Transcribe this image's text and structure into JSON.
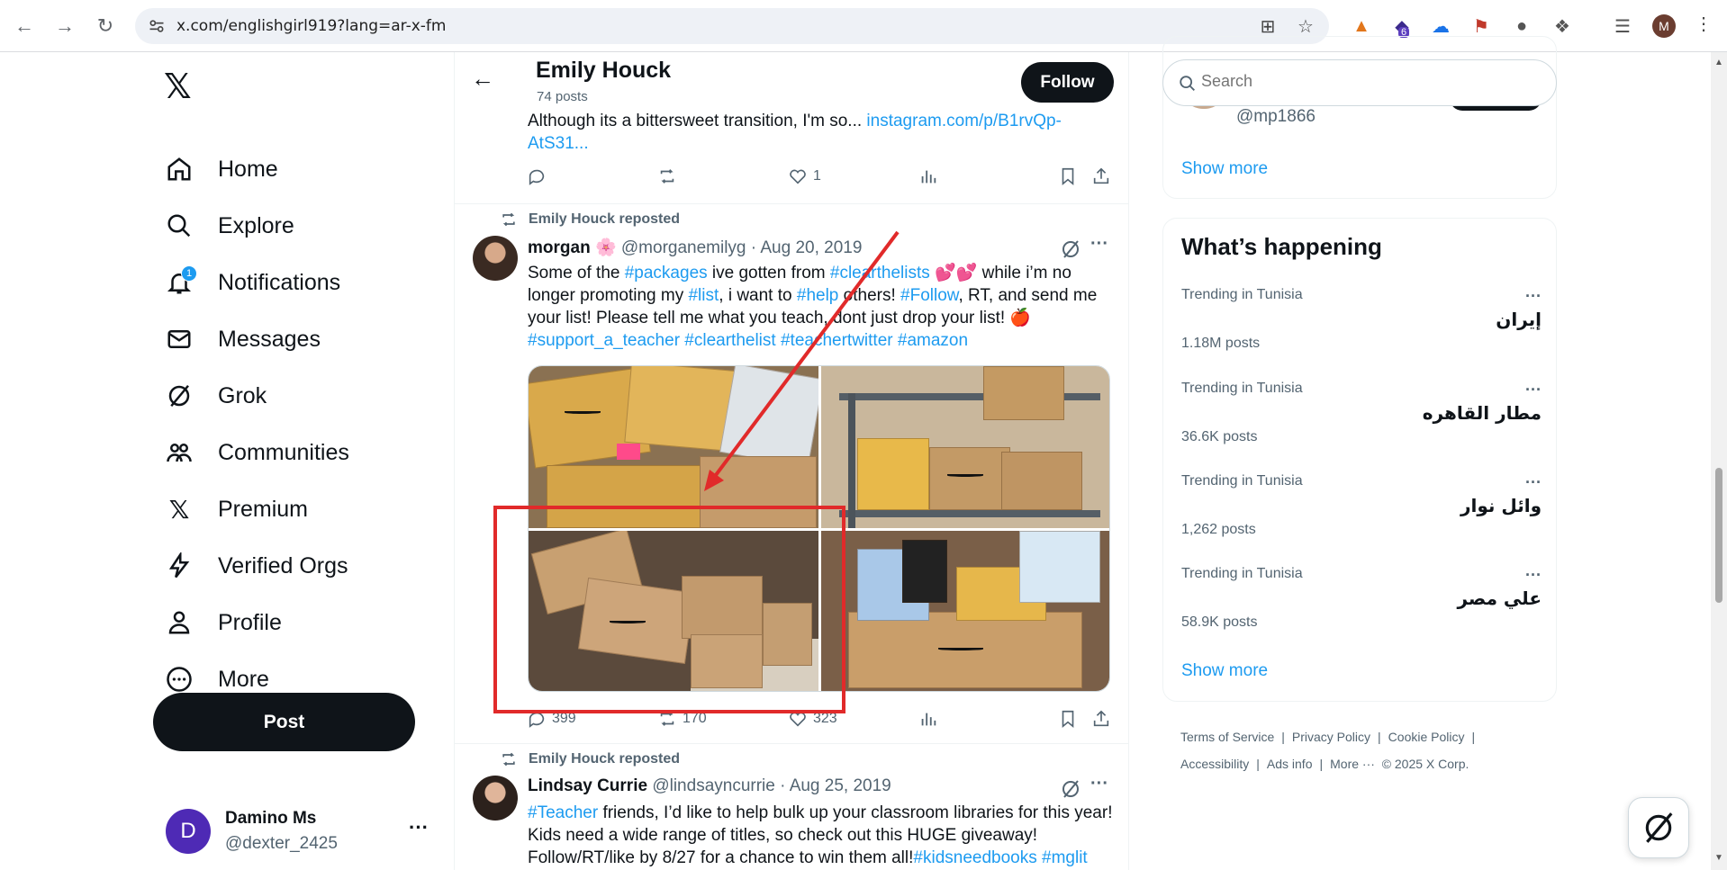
{
  "browser": {
    "url": "x.com/englishgirl919?lang=ar-x-fm",
    "extension_badge": "6",
    "profile_initial": "M"
  },
  "nav": {
    "items": [
      {
        "label": "Home",
        "icon": "home-icon"
      },
      {
        "label": "Explore",
        "icon": "search-icon"
      },
      {
        "label": "Notifications",
        "icon": "bell-icon",
        "badge": "1"
      },
      {
        "label": "Messages",
        "icon": "mail-icon"
      },
      {
        "label": "Grok",
        "icon": "grok-icon"
      },
      {
        "label": "Communities",
        "icon": "people-icon"
      },
      {
        "label": "Premium",
        "icon": "x-logo-icon"
      },
      {
        "label": "Verified Orgs",
        "icon": "lightning-icon"
      },
      {
        "label": "Profile",
        "icon": "person-icon"
      },
      {
        "label": "More",
        "icon": "more-circle-icon"
      }
    ],
    "post_label": "Post"
  },
  "account": {
    "initial": "D",
    "name": "Damino Ms",
    "handle": "@dexter_2425"
  },
  "header": {
    "name": "Emily Houck",
    "posts": "74 posts",
    "follow_label": "Follow"
  },
  "top_tweet": {
    "text": "Although its a bittersweet transition, I'm so... ",
    "link": "instagram.com/p/B1rvQp-AtS31...",
    "likes": "1"
  },
  "tweet1": {
    "repost": "Emily Houck reposted",
    "name": "morgan 🌸",
    "handle": "@morganemilyg",
    "date": "Aug 20, 2019",
    "text_parts": [
      {
        "t": "Some of the ",
        "link": false
      },
      {
        "t": "#packages",
        "link": true
      },
      {
        "t": " ive gotten from ",
        "link": false
      },
      {
        "t": "#clearthelists",
        "link": true
      },
      {
        "t": " 💕💕 while i’m no longer promoting my ",
        "link": false
      },
      {
        "t": "#list",
        "link": true
      },
      {
        "t": ", i want to ",
        "link": false
      },
      {
        "t": "#help",
        "link": true
      },
      {
        "t": " others! ",
        "link": false
      },
      {
        "t": "#Follow",
        "link": true
      },
      {
        "t": ", RT, and send me your list! Please tell me what you teach, dont just drop your list! 🍎 ",
        "link": false
      },
      {
        "t": "#support_a_teacher",
        "link": true
      },
      {
        "t": " ",
        "link": false
      },
      {
        "t": "#clearthelist",
        "link": true
      },
      {
        "t": " ",
        "link": false
      },
      {
        "t": "#teachertwitter",
        "link": true
      },
      {
        "t": " ",
        "link": false
      },
      {
        "t": "#amazon",
        "link": true
      }
    ],
    "replies": "399",
    "reposts": "170",
    "likes": "323"
  },
  "tweet2": {
    "repost": "Emily Houck reposted",
    "name": "Lindsay Currie",
    "handle": "@lindsayncurrie",
    "date": "Aug 25, 2019",
    "text_parts": [
      {
        "t": "#Teacher",
        "link": true
      },
      {
        "t": " friends, I’d like to help bulk up your classroom libraries for this year! Kids need a wide range of titles, so check out this HUGE giveaway! Follow/RT/like by 8/27 for a chance to win them all!",
        "link": false
      },
      {
        "t": "#kidsneedbooks",
        "link": true
      },
      {
        "t": " ",
        "link": false
      },
      {
        "t": "#mglit",
        "link": true
      }
    ]
  },
  "sidebar": {
    "search_placeholder": "Search",
    "wtf_handle": "@mp1866",
    "wtf_show_more": "Show more",
    "happening_title": "What’s happening",
    "trends": [
      {
        "context": "Trending in Tunisia",
        "name": "إيران",
        "count": "1.18M posts"
      },
      {
        "context": "Trending in Tunisia",
        "name": "مطار القاهره",
        "count": "36.6K posts"
      },
      {
        "context": "Trending in Tunisia",
        "name": "وائل نوار",
        "count": "1,262 posts"
      },
      {
        "context": "Trending in Tunisia",
        "name": "علي مصر",
        "count": "58.9K posts"
      }
    ],
    "happening_show_more": "Show more",
    "footer": {
      "terms": "Terms of Service",
      "privacy": "Privacy Policy",
      "cookie": "Cookie Policy",
      "accessibility": "Accessibility",
      "ads": "Ads info",
      "more": "More ···",
      "copyright": "© 2025 X Corp."
    }
  },
  "colors": {
    "accent": "#1d9bf0",
    "highlight": "#e12a2a",
    "text_primary": "#0f1419",
    "text_secondary": "#536471"
  }
}
